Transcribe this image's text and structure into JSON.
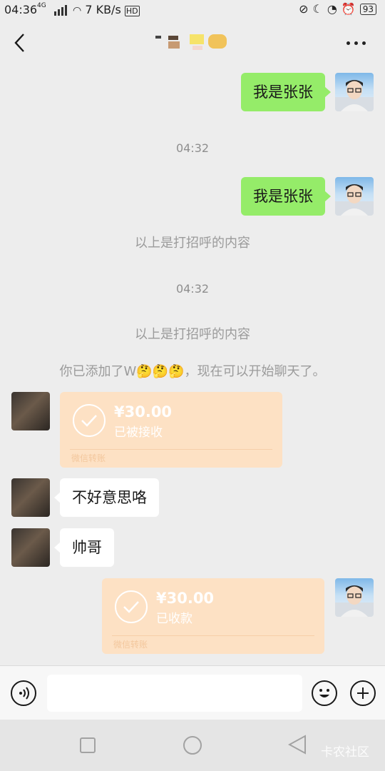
{
  "status_bar": {
    "time": "04:36",
    "network": "4G",
    "speed": "7 KB/s",
    "hd": "HD",
    "battery": "93"
  },
  "header": {
    "title_icon": "blurred-contact-name",
    "back_icon": "chevron-left-icon",
    "more_icon": "more-dots-icon"
  },
  "messages": {
    "m1": "我是张张",
    "ts1": "04:32",
    "m2": "我是张张",
    "sys1": "以上是打招呼的内容",
    "ts2": "04:32",
    "sys2": "以上是打招呼的内容",
    "sys3_prefix": "你已添加了W",
    "sys3_suffix": "，现在可以开始聊天了。",
    "t1": {
      "amount": "¥30.00",
      "status": "已被接收",
      "footer": "微信转账"
    },
    "m3": "不好意思咯",
    "m4": "帅哥",
    "t2": {
      "amount": "¥30.00",
      "status": "已收款",
      "footer": "微信转账"
    }
  },
  "input_bar": {
    "voice_icon": "voice-icon",
    "emoji_icon": "emoji-icon",
    "add_icon": "plus-icon",
    "placeholder": ""
  },
  "nav_bar": {
    "watermark": "卡农社区"
  },
  "colors": {
    "background": "#ededed",
    "my_bubble": "#95ec69",
    "their_bubble": "#ffffff",
    "transfer_card": "#fde1c4"
  }
}
